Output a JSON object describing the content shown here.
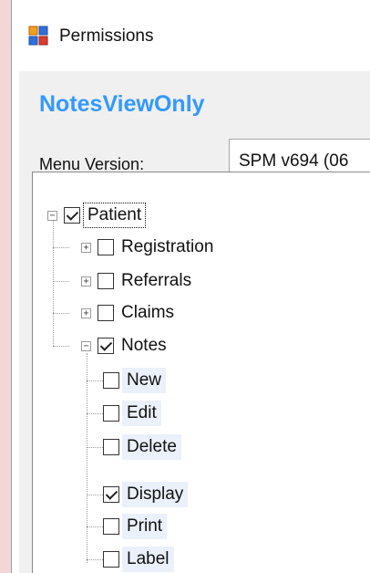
{
  "window": {
    "title": "Permissions",
    "icon": "app-window-icon"
  },
  "form": {
    "heading": "NotesViewOnly",
    "menu_version_label": "Menu Version:",
    "menu_version_value": "SPM v694 (06"
  },
  "tree": {
    "root": {
      "label": "Patient",
      "checked": true,
      "expanded": true
    },
    "children": [
      {
        "label": "Registration",
        "checked": false,
        "expanded": false
      },
      {
        "label": "Referrals",
        "checked": false,
        "expanded": false
      },
      {
        "label": "Claims",
        "checked": false,
        "expanded": false
      },
      {
        "label": "Notes",
        "checked": true,
        "expanded": true
      }
    ],
    "notes_children": [
      {
        "label": "New",
        "checked": false
      },
      {
        "label": "Edit",
        "checked": false
      },
      {
        "label": "Delete",
        "checked": false
      },
      {
        "label": "Display",
        "checked": true
      },
      {
        "label": "Print",
        "checked": false
      },
      {
        "label": "Label",
        "checked": false
      }
    ]
  }
}
